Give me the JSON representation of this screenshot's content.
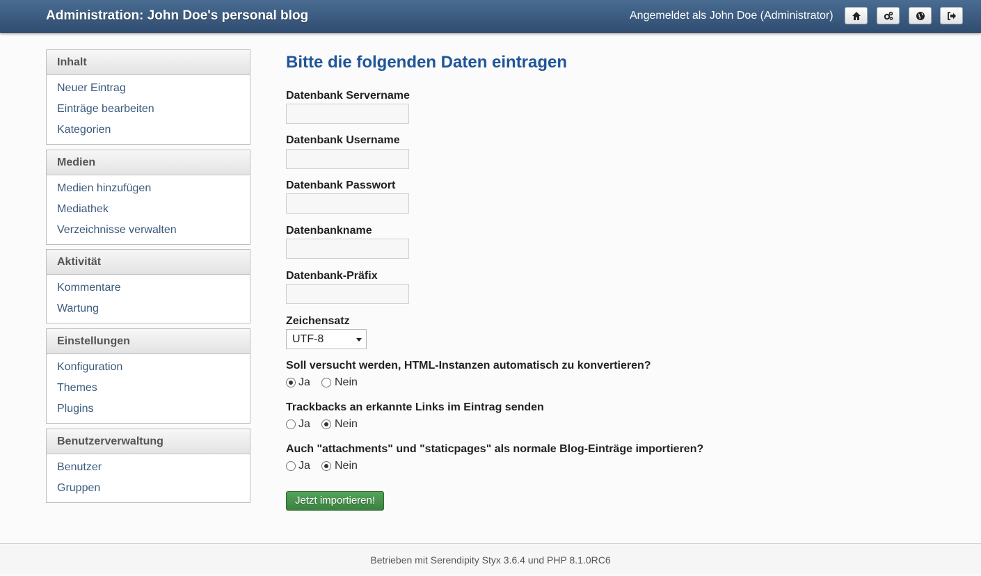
{
  "header": {
    "title": "Administration: John Doe's personal blog",
    "user": "Angemeldet als John Doe (Administrator)",
    "buttons": [
      "home-icon",
      "settings-icon",
      "globe-icon",
      "logout-icon"
    ]
  },
  "sidebar": {
    "sections": [
      {
        "title": "Inhalt",
        "items": [
          "Neuer Eintrag",
          "Einträge bearbeiten",
          "Kategorien"
        ]
      },
      {
        "title": "Medien",
        "items": [
          "Medien hinzufügen",
          "Mediathek",
          "Verzeichnisse verwalten"
        ]
      },
      {
        "title": "Aktivität",
        "items": [
          "Kommentare",
          "Wartung"
        ]
      },
      {
        "title": "Einstellungen",
        "items": [
          "Konfiguration",
          "Themes",
          "Plugins"
        ]
      },
      {
        "title": "Benutzerverwaltung",
        "items": [
          "Benutzer",
          "Gruppen"
        ]
      }
    ]
  },
  "main": {
    "title": "Bitte die folgenden Daten eintragen",
    "fields": [
      {
        "label": "Datenbank Servername",
        "value": ""
      },
      {
        "label": "Datenbank Username",
        "value": ""
      },
      {
        "label": "Datenbank Passwort",
        "value": ""
      },
      {
        "label": "Datenbankname",
        "value": ""
      },
      {
        "label": "Datenbank-Präfix",
        "value": ""
      }
    ],
    "charset": {
      "label": "Zeichensatz",
      "selected": "UTF-8"
    },
    "questions": [
      {
        "label": "Soll versucht werden, HTML-Instanzen automatisch zu konvertieren?",
        "yes": "Ja",
        "no": "Nein",
        "selected": "yes"
      },
      {
        "label": "Trackbacks an erkannte Links im Eintrag senden",
        "yes": "Ja",
        "no": "Nein",
        "selected": "no"
      },
      {
        "label": "Auch \"attachments\" und \"staticpages\" als normale Blog-Einträge importieren?",
        "yes": "Ja",
        "no": "Nein",
        "selected": "no"
      }
    ],
    "submit": "Jetzt importieren!"
  },
  "footer": {
    "text": "Betrieben mit Serendipity Styx 3.6.4 und PHP 8.1.0RC6"
  }
}
